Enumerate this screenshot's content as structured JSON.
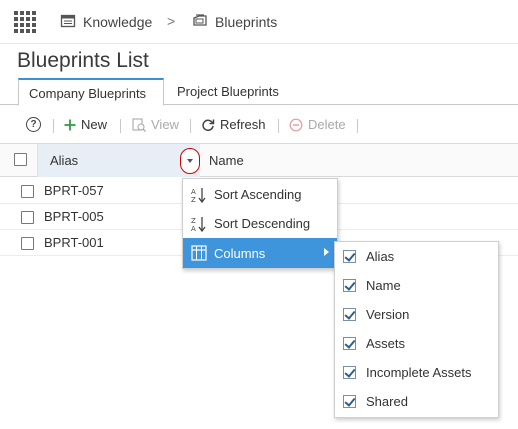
{
  "breadcrumb": {
    "items": [
      {
        "label": "Knowledge",
        "icon": "knowledge-icon"
      },
      {
        "label": "Blueprints",
        "icon": "blueprints-icon"
      }
    ],
    "separator": ">"
  },
  "page": {
    "title": "Blueprints List"
  },
  "tabs": [
    {
      "label": "Company Blueprints",
      "active": true
    },
    {
      "label": "Project Blueprints",
      "active": false
    }
  ],
  "toolbar": {
    "help": "?",
    "new_label": "New",
    "view_label": "View",
    "refresh_label": "Refresh",
    "delete_label": "Delete"
  },
  "grid": {
    "columns": [
      "Alias",
      "Name"
    ],
    "rows": [
      {
        "alias": "BPRT-057"
      },
      {
        "alias": "BPRT-005"
      },
      {
        "alias": "BPRT-001"
      }
    ]
  },
  "column_menu": {
    "items": [
      {
        "label": "Sort Ascending",
        "icon": "sort-ascending-icon"
      },
      {
        "label": "Sort Descending",
        "icon": "sort-descending-icon"
      },
      {
        "label": "Columns",
        "icon": "columns-icon",
        "has_submenu": true
      }
    ]
  },
  "columns_submenu": {
    "items": [
      {
        "label": "Alias",
        "checked": true
      },
      {
        "label": "Name",
        "checked": true
      },
      {
        "label": "Version",
        "checked": true
      },
      {
        "label": "Assets",
        "checked": true
      },
      {
        "label": "Incomplete Assets",
        "checked": true
      },
      {
        "label": "Shared",
        "checked": true
      }
    ]
  },
  "colors": {
    "accent": "#3f95db",
    "tab_border": "#3b8fd3",
    "highlight_ring": "#d40000",
    "new_plus": "#2e9e4a"
  }
}
